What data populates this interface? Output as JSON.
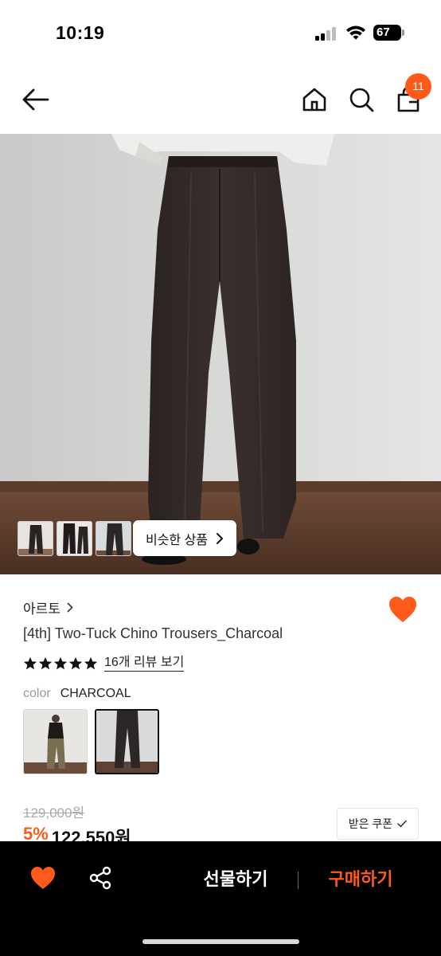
{
  "status_bar": {
    "time": "10:19",
    "battery_level": "67",
    "icons": [
      "signal-icon",
      "wifi-icon",
      "battery-icon"
    ]
  },
  "nav": {
    "icons": [
      "back-arrow-icon",
      "home-icon",
      "search-icon",
      "shopping-bag-icon"
    ],
    "cart_count": "11"
  },
  "gallery": {
    "similar_label": "비슷한 상품",
    "thumbnail_count": 3
  },
  "product": {
    "brand": "아르토",
    "name": "[4th] Two-Tuck Chino Trousers_Charcoal",
    "rating_stars": 5,
    "review_label": "16개 리뷰 보기",
    "color_key": "color",
    "color_value": "CHARCOAL",
    "original_price": "129,000원",
    "discount": "5%",
    "sale_price": "122,550원",
    "coupon_label": "받은 쿠폰",
    "wishlisted": true
  },
  "bottom_bar": {
    "gift_label": "선물하기",
    "buy_label": "구매하기"
  },
  "colors": {
    "accent": "#ff5a1a",
    "bottom_bar_bg": "#000000",
    "text": "#222222"
  }
}
